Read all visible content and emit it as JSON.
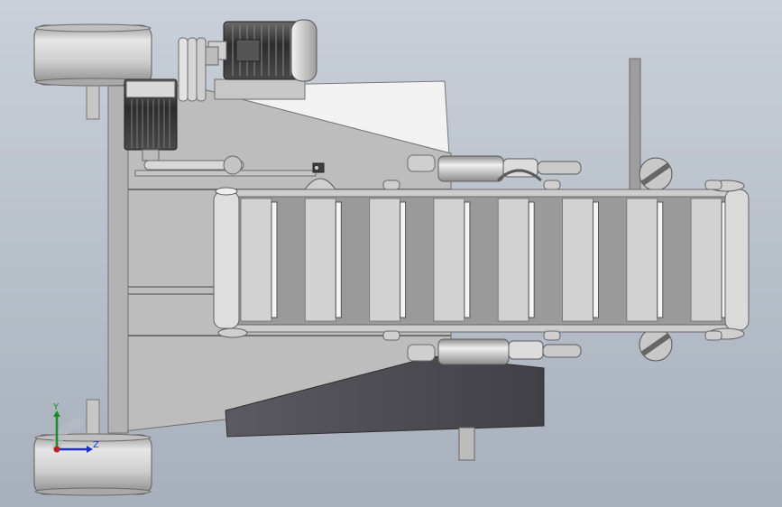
{
  "viewport": {
    "background_top": "#c9d0d9",
    "background_bottom": "#a7b0bb"
  },
  "triad": {
    "y_label": "Y",
    "z_label": "Z",
    "y_color": "#1a8a2a",
    "z_color": "#1f2fcf",
    "x_color": "#c0201f"
  },
  "model": {
    "frame_color": "#bdbdbd",
    "frame_dark": "#8f8f8f",
    "conveyor_light": "#d2d2d2",
    "conveyor_dark": "#9a9a9a",
    "skirt_color": "#4e4e55",
    "motor_color": "#3a3a3a"
  }
}
